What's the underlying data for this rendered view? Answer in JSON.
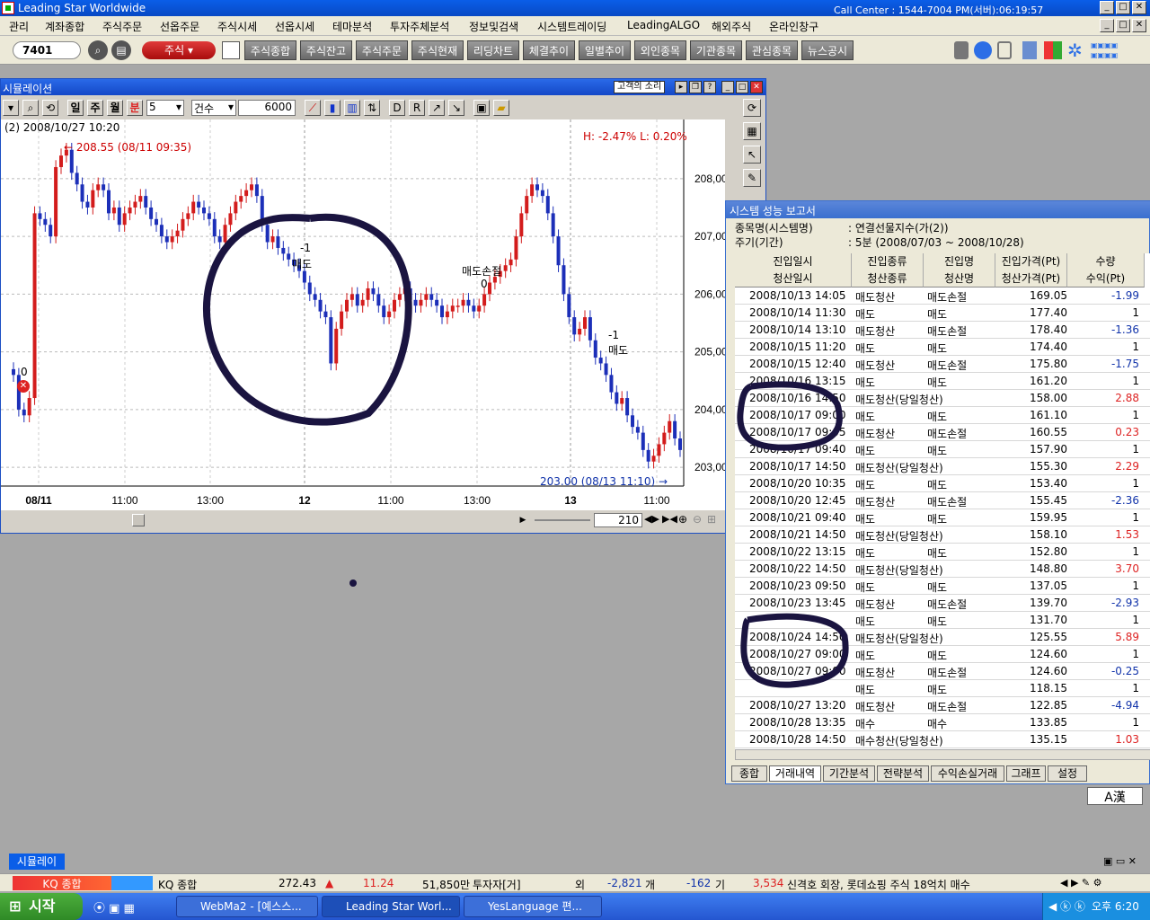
{
  "title_bar": {
    "title": "Leading Star Worldwide",
    "call_center": "Call Center : 1544-7004  PM(서버):06:19:57"
  },
  "menu": [
    "관리",
    "계좌종합",
    "주식주문",
    "선옵주문",
    "주식시세",
    "선옵시세",
    "테마분석",
    "투자주체분석",
    "정보및검색",
    "시스템트레이딩",
    "LeadingALGO",
    "해외주식",
    "온라인창구"
  ],
  "toolbar": {
    "code": "7401",
    "stock_label": "주식",
    "buttons": [
      "주식종합",
      "주식잔고",
      "주식주문",
      "주식현재",
      "리딩차트",
      "체결추이",
      "일별추이",
      "외인종목",
      "기관종목",
      "관심종목",
      "뉴스공시"
    ]
  },
  "chart_window": {
    "title": "시뮬레이션",
    "voice_button": "고객의 소리",
    "period_buttons": [
      "일",
      "주",
      "월",
      "분"
    ],
    "interval": "5",
    "count_label": "건수",
    "count_value": "6000",
    "info_label": "(2) 2008/10/27 10:20",
    "high_low": "H: -2.47%   L: 0.20%",
    "high_note": "208.55 (08/11 09:35)",
    "low_note": "203.00 (08/13 11:10)",
    "zoom_value": "210",
    "annotations": [
      {
        "text": "-1"
      },
      {
        "text": "매도"
      },
      {
        "text": "매도손절"
      },
      {
        "text": "0"
      },
      {
        "text": "-1"
      },
      {
        "text": "매도"
      },
      {
        "text": "0"
      }
    ]
  },
  "chart_data": {
    "type": "candlestick",
    "x_ticks": [
      "08/11",
      "11:00",
      "13:00",
      "12",
      "11:00",
      "13:00",
      "13",
      "11:00"
    ],
    "y_ticks": [
      "208,00",
      "207,00",
      "206,00",
      "205,00",
      "204,00",
      "203,00"
    ],
    "ylim": [
      202.8,
      208.9
    ],
    "high": 208.55,
    "low": 203.0,
    "closes": [
      204.6,
      204.0,
      203.9,
      204.2,
      207.4,
      207.3,
      207.2,
      207.0,
      208.2,
      208.4,
      208.5,
      208.1,
      207.9,
      207.6,
      207.5,
      207.8,
      207.9,
      207.8,
      207.4,
      207.5,
      207.2,
      207.4,
      207.5,
      207.6,
      207.7,
      207.5,
      207.3,
      207.2,
      207.0,
      206.9,
      207.0,
      207.1,
      207.3,
      207.4,
      207.6,
      207.5,
      207.4,
      207.3,
      207.0,
      206.9,
      207.2,
      207.4,
      207.6,
      207.7,
      207.8,
      207.9,
      207.7,
      207.2,
      206.9,
      207.0,
      206.8,
      206.7,
      206.6,
      206.5,
      206.4,
      206.2,
      206.0,
      205.9,
      205.7,
      205.6,
      204.8,
      205.4,
      205.7,
      205.9,
      206.0,
      205.8,
      205.9,
      206.1,
      206.0,
      205.8,
      205.6,
      205.7,
      205.9,
      206.0,
      206.1,
      205.9,
      205.8,
      205.9,
      206.0,
      205.9,
      205.8,
      205.6,
      205.7,
      205.8,
      205.8,
      205.9,
      205.8,
      205.7,
      205.8,
      206.0,
      206.2,
      206.3,
      206.4,
      206.5,
      206.6,
      207.0,
      207.4,
      207.7,
      207.9,
      207.8,
      207.7,
      207.4,
      207.0,
      206.5,
      206.0,
      205.6,
      205.3,
      205.4,
      205.6,
      205.2,
      204.9,
      204.8,
      204.6,
      204.3,
      204.1,
      204.2,
      203.9,
      203.7,
      203.6,
      203.3,
      203.1,
      203.2,
      203.4,
      203.6,
      203.8,
      203.5,
      203.3
    ]
  },
  "report": {
    "title": "시스템 성능 보고서",
    "item_label": "종목명(시스템명)",
    "item_value": ": 연결선물지수(가(2))",
    "period_label": "주기(기간)",
    "period_value": ": 5분 (2008/07/03 ~ 2008/10/28)",
    "headers": [
      [
        "진입일시",
        "청산일시"
      ],
      [
        "진입종류",
        "청산종류"
      ],
      [
        "진입명",
        "청산명"
      ],
      [
        "진입가격(Pt)",
        "청산가격(Pt)"
      ],
      [
        "수량",
        "수익(Pt)"
      ]
    ],
    "rows": [
      [
        "2008/10/13 14:05",
        "매도청산",
        "매도손절",
        "169.05",
        "-1.99",
        "blue"
      ],
      [
        "2008/10/14 11:30",
        "매도",
        "매도",
        "177.40",
        "1",
        ""
      ],
      [
        "2008/10/14 13:10",
        "매도청산",
        "매도손절",
        "178.40",
        "-1.36",
        "blue"
      ],
      [
        "2008/10/15 11:20",
        "매도",
        "매도",
        "174.40",
        "1",
        ""
      ],
      [
        "2008/10/15 12:40",
        "매도청산",
        "매도손절",
        "175.80",
        "-1.75",
        "blue"
      ],
      [
        "2008/10/16 13:15",
        "매도",
        "매도",
        "161.20",
        "1",
        ""
      ],
      [
        "2008/10/16 14:50",
        "매도청산(당일청산)",
        "",
        "158.00",
        "2.88",
        "red"
      ],
      [
        "2008/10/17 09:00",
        "매도",
        "매도",
        "161.10",
        "1",
        ""
      ],
      [
        "2008/10/17 09:05",
        "매도청산",
        "매도손절",
        "160.55",
        "0.23",
        "red"
      ],
      [
        "2008/10/17 09:40",
        "매도",
        "매도",
        "157.90",
        "1",
        ""
      ],
      [
        "2008/10/17 14:50",
        "매도청산(당일청산)",
        "",
        "155.30",
        "2.29",
        "red"
      ],
      [
        "2008/10/20 10:35",
        "매도",
        "매도",
        "153.40",
        "1",
        ""
      ],
      [
        "2008/10/20 12:45",
        "매도청산",
        "매도손절",
        "155.45",
        "-2.36",
        "blue"
      ],
      [
        "2008/10/21 09:40",
        "매도",
        "매도",
        "159.95",
        "1",
        ""
      ],
      [
        "2008/10/21 14:50",
        "매도청산(당일청산)",
        "",
        "158.10",
        "1.53",
        "red"
      ],
      [
        "2008/10/22 13:15",
        "매도",
        "매도",
        "152.80",
        "1",
        ""
      ],
      [
        "2008/10/22 14:50",
        "매도청산(당일청산)",
        "",
        "148.80",
        "3.70",
        "red"
      ],
      [
        "2008/10/23 09:50",
        "매도",
        "매도",
        "137.05",
        "1",
        ""
      ],
      [
        "2008/10/23 13:45",
        "매도청산",
        "매도손절",
        "139.70",
        "-2.93",
        "blue"
      ],
      [
        "",
        "매도",
        "매도",
        "131.70",
        "1",
        ""
      ],
      [
        "2008/10/24 14:50",
        "매도청산(당일청산)",
        "",
        "125.55",
        "5.89",
        "red"
      ],
      [
        "2008/10/27 09:00",
        "매도",
        "매도",
        "124.60",
        "1",
        ""
      ],
      [
        "2008/10/27 09:00",
        "매도청산",
        "매도손절",
        "124.60",
        "-0.25",
        "blue"
      ],
      [
        "",
        "매도",
        "매도",
        "118.15",
        "1",
        ""
      ],
      [
        "2008/10/27 13:20",
        "매도청산",
        "매도손절",
        "122.85",
        "-4.94",
        "blue"
      ],
      [
        "2008/10/28 13:35",
        "매수",
        "매수",
        "133.85",
        "1",
        ""
      ],
      [
        "2008/10/28 14:50",
        "매수청산(당일청산)",
        "",
        "135.15",
        "1.03",
        "red"
      ]
    ],
    "tabs": [
      "종합",
      "거래내역",
      "기간분석",
      "전략분석",
      "수익손실거래",
      "그래프",
      "설정"
    ],
    "lang_button": "A漢"
  },
  "status": {
    "sim_tab": "시뮬레이",
    "kq_label": "KQ 종합",
    "kq_name": "KQ 종합",
    "kq_value": "272.43",
    "kq_change": "11.24",
    "kq_volume": "51,850만",
    "investor": "투자자[거]",
    "foreign_label": "외",
    "foreign_value": "-2,821",
    "unit": "개",
    "inst_value": "-162",
    "inst_label": "기",
    "other_value": "3,534",
    "news": "신격호 회장, 롯데쇼핑 주식 18억치 매수"
  },
  "taskbar": {
    "start": "시작",
    "tasks": [
      "WebMa2 - [예스스...",
      "Leading Star Worl...",
      "YesLanguage 편..."
    ],
    "clock": "오후 6:20"
  }
}
